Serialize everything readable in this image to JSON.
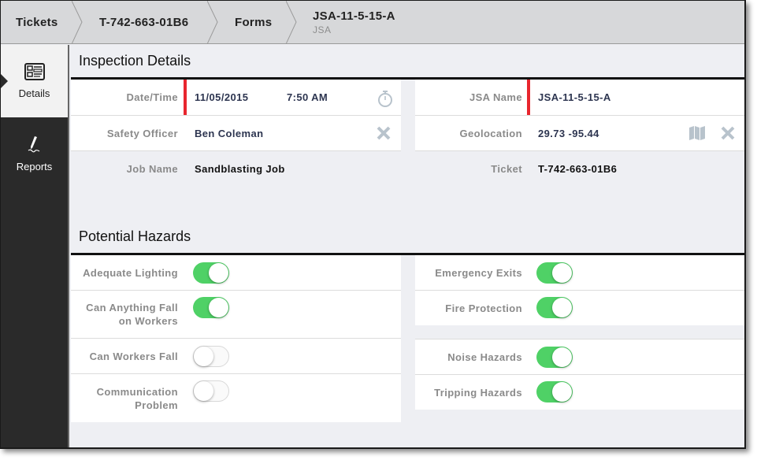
{
  "breadcrumb": [
    {
      "label": "Tickets"
    },
    {
      "label": "T-742-663-01B6"
    },
    {
      "label": "Forms"
    },
    {
      "label": "JSA-11-5-15-A",
      "sub": "JSA"
    }
  ],
  "sidebar": {
    "items": [
      {
        "label": "Details",
        "icon": "details-icon",
        "active": true
      },
      {
        "label": "Reports",
        "icon": "pen-icon",
        "active": false
      }
    ]
  },
  "inspection": {
    "title": "Inspection Details",
    "left": [
      {
        "label": "Date/Time",
        "date": "11/05/2015",
        "time": "7:50 AM",
        "icon": "stopwatch-icon"
      },
      {
        "label": "Safety Officer",
        "value": "Ben Coleman",
        "icon": "clear-icon"
      },
      {
        "label": "Job Name",
        "value": "Sandblasting Job"
      }
    ],
    "right": [
      {
        "label": "JSA Name",
        "value": "JSA-11-5-15-A"
      },
      {
        "label": "Geolocation",
        "value": "29.73 -95.44",
        "icons": [
          "map-icon",
          "clear-icon"
        ]
      },
      {
        "label": "Ticket",
        "value": "T-742-663-01B6"
      }
    ]
  },
  "hazards": {
    "title": "Potential Hazards",
    "left": [
      {
        "label": "Adequate Lighting",
        "on": true
      },
      {
        "label": "Can Anything Fall on Workers",
        "on": true
      },
      {
        "label": "Can Workers Fall",
        "on": false
      },
      {
        "label": "Communication Problem",
        "on": false
      }
    ],
    "right": [
      {
        "label": "Emergency Exits",
        "on": true
      },
      {
        "label": "Fire Protection",
        "on": true
      },
      {
        "label": "Noise Hazards",
        "on": true
      },
      {
        "label": "Tripping Hazards",
        "on": true
      }
    ]
  },
  "colors": {
    "accent_required": "#e8262e",
    "toggle_on": "#4fd166",
    "icon_grey": "#b8c3cc"
  }
}
